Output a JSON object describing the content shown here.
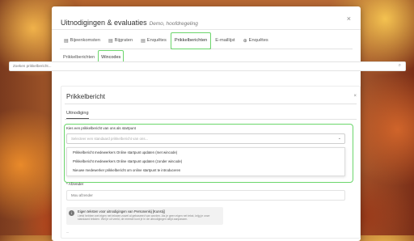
{
  "modal": {
    "title": "Uitnodigingen & evaluaties",
    "subtitle": "Demo, hoofdregeling",
    "close_icon": "close-icon"
  },
  "tabs": [
    {
      "icon": "calendar-icon",
      "label": "Bijeenkomsten"
    },
    {
      "icon": "calendar-icon",
      "label": "Bijgraten"
    },
    {
      "icon": "calendar-icon",
      "label": "Enquêtes"
    },
    {
      "label": "Prikkelberichten",
      "active": true
    },
    {
      "label": "E-maillijst"
    },
    {
      "icon": "list-icon",
      "label": "Enquêtes"
    }
  ],
  "subtabs": [
    {
      "label": "Prikkelberichten"
    },
    {
      "label": "Wincodes",
      "active": true
    }
  ],
  "search": {
    "placeholder": "Zoeken prikkelbericht..."
  },
  "panel": {
    "title": "Prikkelbericht",
    "tab_label": "Uitnodiging"
  },
  "select": {
    "label": "Kies een prikkelbericht van ons als startpunt",
    "placeholder": "Selecteer een standaard prikkelbericht van ons...",
    "options": [
      "Prikkelbericht medewerkers Online startpunt updaten (met wincode)",
      "Prikkelbericht medewerkers Online startpunt updaten (zonder wincode)",
      "Nieuwe medewerker prikkelbericht om online startpunt te introduceren"
    ]
  },
  "sender": {
    "label": "* Afzender",
    "placeholder": "Mou afzender"
  },
  "own_text": {
    "title": "Eigen teksten voor uitnodigingen van Personenkij [Kunstij]",
    "description": "Liefst hebben wet eigen net teksten zowel al gebaseerd van worden. Als je geen eigen net tekst, krijg je onze standaard teksten. Wel je uit veeld, de meeste kunt je in de uitnodigingen altijd aanpassen."
  },
  "bottom_text": "..."
}
